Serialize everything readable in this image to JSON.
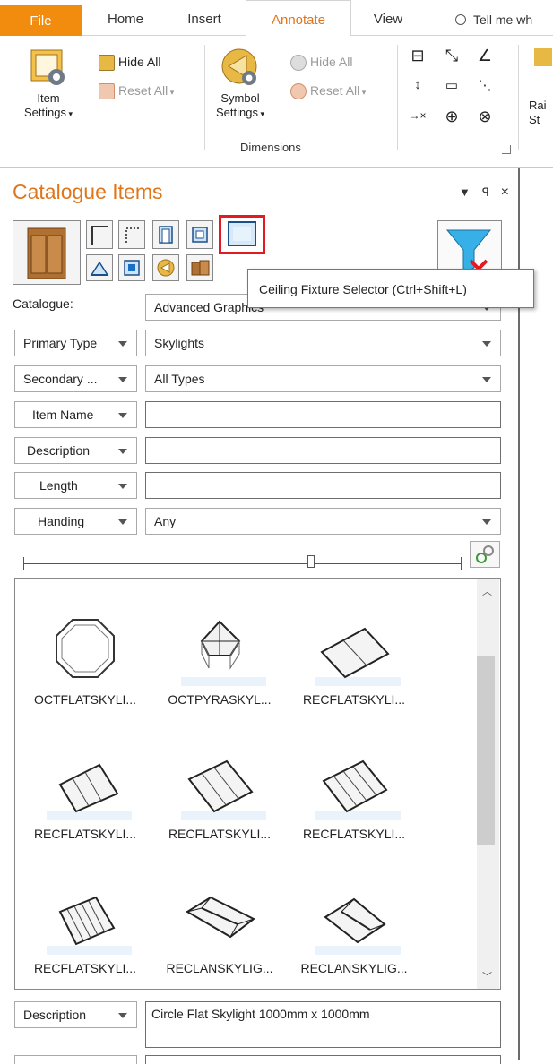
{
  "tabs": {
    "file": "File",
    "home": "Home",
    "insert": "Insert",
    "annotate": "Annotate",
    "view": "View",
    "tell_me": "Tell me wh"
  },
  "ribbon": {
    "item_settings": {
      "line1": "Item",
      "line2": "Settings"
    },
    "hide_all_1": "Hide All",
    "reset_all_1": "Reset All",
    "symbol_settings": {
      "line1": "Symbol",
      "line2": "Settings"
    },
    "hide_all_2": "Hide All",
    "reset_all_2": "Reset All",
    "dimensions_group": "Dimensions",
    "rail_label": {
      "line1": "Rai",
      "line2": "St"
    }
  },
  "panel": {
    "title": "Catalogue Items",
    "tooltip": "Ceiling Fixture Selector (Ctrl+Shift+L)",
    "catalogue_label": "Catalogue:",
    "catalogue_value": "Advanced Graphics",
    "filters": [
      {
        "label": "Primary Type",
        "value": "Skylights"
      },
      {
        "label": "Secondary ...",
        "value": "All Types"
      },
      {
        "label": "Item Name",
        "value": ""
      },
      {
        "label": "Description",
        "value": ""
      },
      {
        "label": "Length",
        "value": ""
      },
      {
        "label": "Handing",
        "value": "Any"
      }
    ],
    "items": [
      "OCTFLATSKYLI...",
      "OCTPYRASKYL...",
      "RECFLATSKYLI...",
      "RECFLATSKYLI...",
      "RECFLATSKYLI...",
      "RECFLATSKYLI...",
      "RECFLATSKYLI...",
      "RECLANSKYLIG...",
      "RECLANSKYLIG..."
    ],
    "bottom_label": "Description",
    "bottom_value": "Circle Flat Skylight 1000mm x 1000mm"
  },
  "colors": {
    "accent": "#e0761b",
    "file_tab": "#f28c0e",
    "selection": "#e21b23"
  }
}
